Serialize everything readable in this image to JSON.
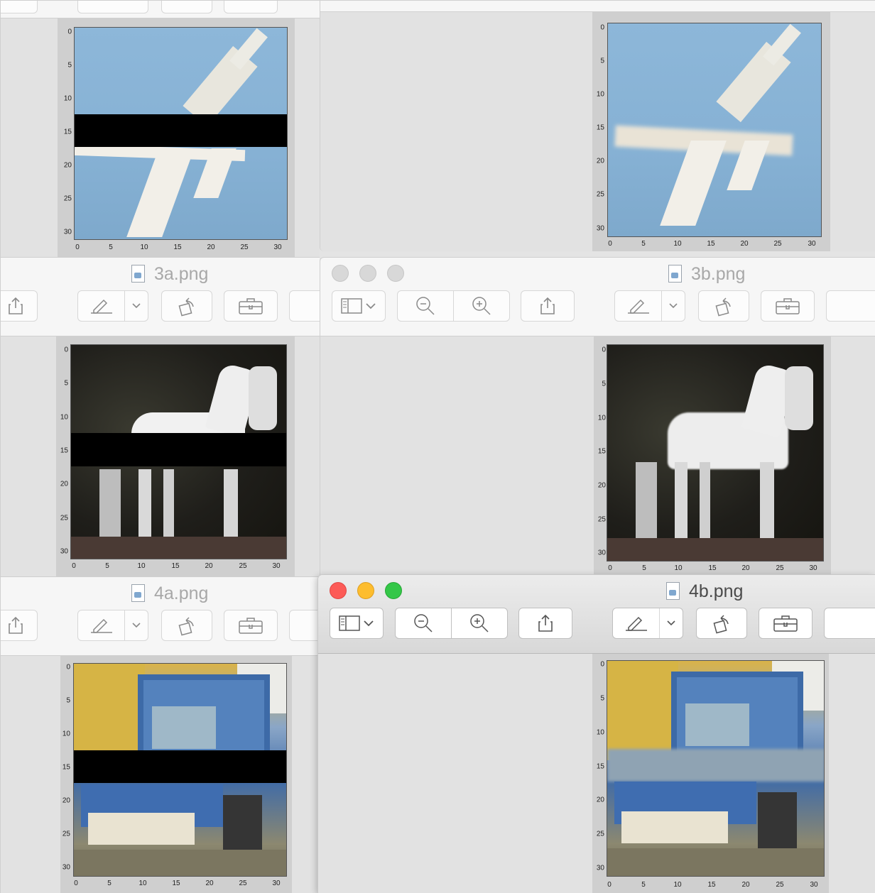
{
  "windows": [
    {
      "id": "win-3a",
      "title": "3a.png",
      "state": "inactive"
    },
    {
      "id": "win-3b",
      "title": "3b.png",
      "state": "inactive"
    },
    {
      "id": "win-4a",
      "title": "4a.png",
      "state": "inactive"
    },
    {
      "id": "win-4b",
      "title": "4b.png",
      "state": "active"
    }
  ],
  "titles": {
    "w3a": "3a.png",
    "w3b": "3b.png",
    "w4a": "4a.png",
    "w4b": "4b.png"
  },
  "toolbar_icons": [
    "sidebar-icon",
    "chevron-down-icon",
    "zoom-out-icon",
    "zoom-in-icon",
    "share-icon",
    "markup-pen-icon",
    "rotate-icon",
    "toolbox-icon"
  ],
  "axes": {
    "y_ticks": [
      "0",
      "5",
      "10",
      "15",
      "20",
      "25",
      "30"
    ],
    "x_ticks": [
      "0",
      "5",
      "10",
      "15",
      "20",
      "25",
      "30"
    ]
  },
  "images": [
    {
      "id": "plane-occluded",
      "subject": "airplane",
      "occluded": true
    },
    {
      "id": "plane-restored",
      "subject": "airplane",
      "occluded": false
    },
    {
      "id": "horse-occluded",
      "subject": "horse",
      "occluded": true
    },
    {
      "id": "horse-restored",
      "subject": "horse",
      "occluded": false
    },
    {
      "id": "truck-occluded",
      "subject": "truck",
      "occluded": true
    },
    {
      "id": "truck-restored",
      "subject": "truck",
      "occluded": false
    }
  ],
  "colors": {
    "close": "#fc5b57",
    "minimize": "#fdbd2e",
    "zoom": "#34c748",
    "sky": "#8db7d9",
    "occlusion": "#000000"
  }
}
